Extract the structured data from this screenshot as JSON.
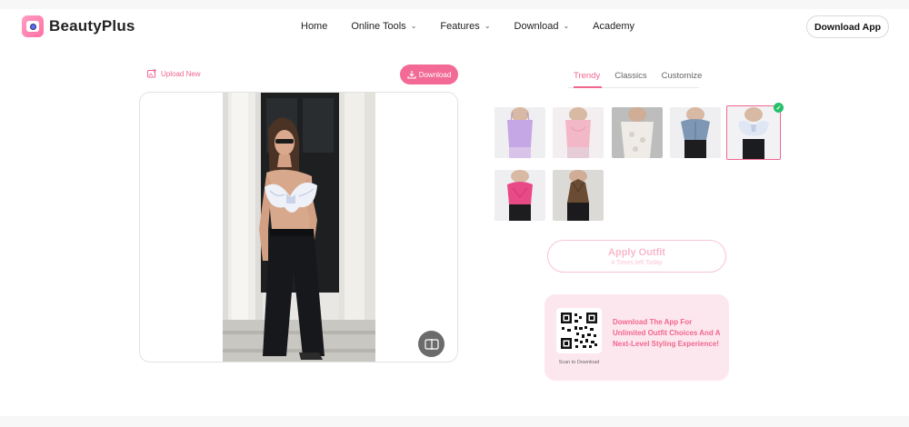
{
  "app": {
    "name": "BeautyPlus"
  },
  "nav": {
    "items": [
      {
        "label": "Home",
        "has_dropdown": false
      },
      {
        "label": "Online Tools",
        "has_dropdown": true
      },
      {
        "label": "Features",
        "has_dropdown": true
      },
      {
        "label": "Download",
        "has_dropdown": true
      },
      {
        "label": "Academy",
        "has_dropdown": false
      }
    ],
    "download_app_label": "Download App"
  },
  "editor": {
    "upload_new_label": "Upload New",
    "download_label": "Download",
    "compare_icon": "compare-icon"
  },
  "outfits": {
    "tabs": [
      {
        "label": "Trendy",
        "active": true
      },
      {
        "label": "Classics",
        "active": false
      },
      {
        "label": "Customize",
        "active": false
      }
    ],
    "items": [
      {
        "name": "lavender-cami-top",
        "color": "#c9a9e6"
      },
      {
        "name": "pink-satin-cami",
        "color": "#f2b6c6"
      },
      {
        "name": "white-lace-top",
        "color": "#e8e4e0"
      },
      {
        "name": "denim-corset-top",
        "color": "#7f97b4"
      },
      {
        "name": "white-bow-top",
        "color": "#dfe6f3",
        "selected": true
      },
      {
        "name": "hot-pink-corset",
        "color": "#e94a86"
      },
      {
        "name": "brown-halter-top",
        "color": "#6b4d35"
      }
    ],
    "apply_label": "Apply Outfit",
    "times_left": "4 Times left Today"
  },
  "promo": {
    "scan_label": "Scan to Download",
    "text": "Download The App For Unlimited Outfit Choices And A Next-Level Styling Experience!"
  },
  "colors": {
    "accent": "#f0668f",
    "accent_fill": "#f26a95",
    "promo_bg": "#fde7ee",
    "check": "#27c06a"
  }
}
